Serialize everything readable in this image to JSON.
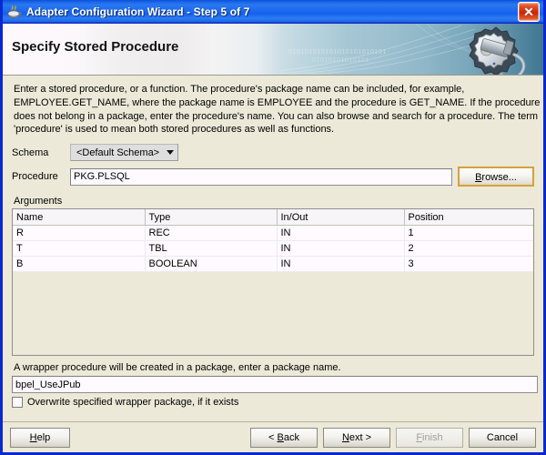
{
  "window": {
    "title": "Adapter Configuration Wizard - Step 5 of 7",
    "icon": "java-coffee-cup-icon",
    "close_label": "Close",
    "border_color": "#0a28d2",
    "titlebar_color": "#1f6af0"
  },
  "banner": {
    "heading": "Specify Stored Procedure",
    "artwork": "gear-and-plug-icon",
    "binary_text_1": "010101010101010101010101",
    "binary_text_2": "01010101010101"
  },
  "description": {
    "line1": "Enter a stored procedure, or a function. The procedure's package name can be included, for example,",
    "line2": "EMPLOYEE.GET_NAME, where the package name is EMPLOYEE and the procedure is GET_NAME.  If the procedure",
    "line3": "does not belong in a package, enter the procedure's name. You can also browse and search for a procedure. The term",
    "line4": "'procedure' is used to mean both stored procedures as well as functions."
  },
  "form": {
    "schema_label": "Schema",
    "schema_value": "<Default Schema>",
    "procedure_label": "Procedure",
    "procedure_value": "PKG.PLSQL",
    "procedure_placeholder": "",
    "browse_label": "Browse...",
    "browse_mnemonic": "B",
    "browse_focus_color": "#d7a13a"
  },
  "arguments": {
    "label": "Arguments",
    "columns": [
      "Name",
      "Type",
      "In/Out",
      "Position"
    ],
    "rows": [
      {
        "name": "R",
        "type": "REC",
        "inout": "IN",
        "position": "1"
      },
      {
        "name": "T",
        "type": "TBL",
        "inout": "IN",
        "position": "2"
      },
      {
        "name": "B",
        "type": "BOOLEAN",
        "inout": "IN",
        "position": "3"
      }
    ]
  },
  "wrapper": {
    "note": "A wrapper procedure will be created in a package, enter a package name.",
    "package_value": "bpel_UseJPub",
    "package_placeholder": "",
    "overwrite_label": "Overwrite specified wrapper package, if it exists",
    "overwrite_checked": false
  },
  "footer": {
    "help_label": "Help",
    "help_mnemonic": "H",
    "back_label": "< Back",
    "back_mnemonic": "B",
    "next_label": "Next >",
    "next_mnemonic": "N",
    "finish_label": "Finish",
    "finish_mnemonic": "F",
    "finish_disabled": true,
    "cancel_label": "Cancel"
  }
}
